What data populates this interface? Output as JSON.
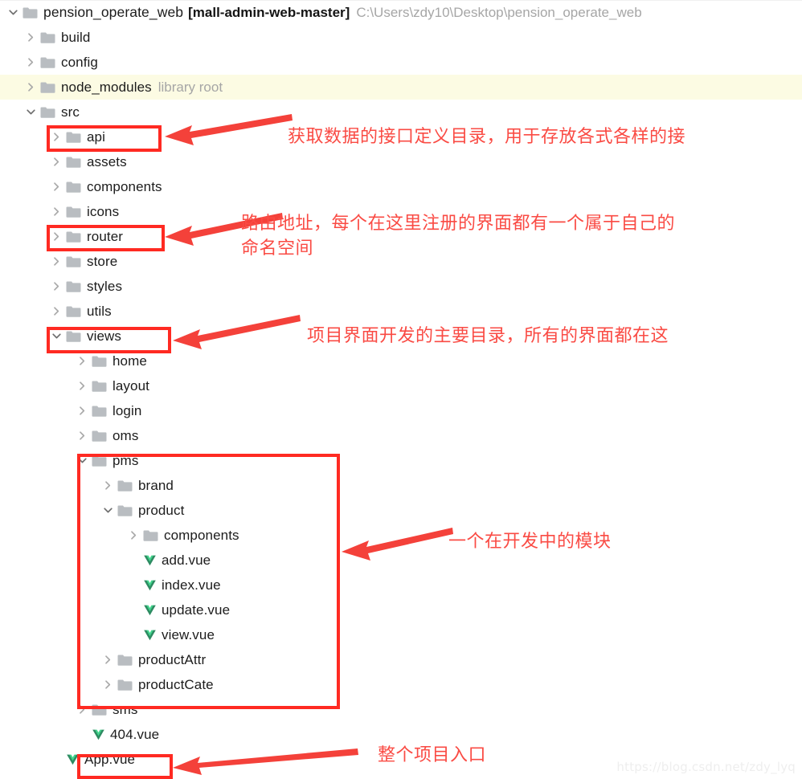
{
  "window": {
    "watermark": "https://blog.csdn.net/zdy_lyq"
  },
  "tree": {
    "root": {
      "name": "pension_operate_web",
      "tag": "[mall-admin-web-master]",
      "path": "C:\\Users\\zdy10\\Desktop\\pension_operate_web"
    },
    "rows": [
      {
        "label": "pension_operate_web",
        "tag": "[mall-admin-web-master]",
        "note": "C:\\Users\\zdy10\\Desktop\\pension_operate_web",
        "kind": "folder",
        "state": "expanded",
        "depth": 0,
        "highlight": false
      },
      {
        "label": "build",
        "tag": "",
        "note": "",
        "kind": "folder",
        "state": "collapsed",
        "depth": 1,
        "highlight": false
      },
      {
        "label": "config",
        "tag": "",
        "note": "",
        "kind": "folder",
        "state": "collapsed",
        "depth": 1,
        "highlight": false
      },
      {
        "label": "node_modules",
        "tag": "",
        "note": "library root",
        "kind": "folder",
        "state": "collapsed",
        "depth": 1,
        "highlight": true
      },
      {
        "label": "src",
        "tag": "",
        "note": "",
        "kind": "folder",
        "state": "expanded",
        "depth": 1,
        "highlight": false
      },
      {
        "label": "api",
        "tag": "",
        "note": "",
        "kind": "folder",
        "state": "collapsed",
        "depth": 2,
        "highlight": false
      },
      {
        "label": "assets",
        "tag": "",
        "note": "",
        "kind": "folder",
        "state": "collapsed",
        "depth": 2,
        "highlight": false
      },
      {
        "label": "components",
        "tag": "",
        "note": "",
        "kind": "folder",
        "state": "collapsed",
        "depth": 2,
        "highlight": false
      },
      {
        "label": "icons",
        "tag": "",
        "note": "",
        "kind": "folder",
        "state": "collapsed",
        "depth": 2,
        "highlight": false
      },
      {
        "label": "router",
        "tag": "",
        "note": "",
        "kind": "folder",
        "state": "collapsed",
        "depth": 2,
        "highlight": false
      },
      {
        "label": "store",
        "tag": "",
        "note": "",
        "kind": "folder",
        "state": "collapsed",
        "depth": 2,
        "highlight": false
      },
      {
        "label": "styles",
        "tag": "",
        "note": "",
        "kind": "folder",
        "state": "collapsed",
        "depth": 2,
        "highlight": false
      },
      {
        "label": "utils",
        "tag": "",
        "note": "",
        "kind": "folder",
        "state": "collapsed",
        "depth": 2,
        "highlight": false
      },
      {
        "label": "views",
        "tag": "",
        "note": "",
        "kind": "folder",
        "state": "expanded",
        "depth": 2,
        "highlight": false
      },
      {
        "label": "home",
        "tag": "",
        "note": "",
        "kind": "folder",
        "state": "collapsed",
        "depth": 3,
        "highlight": false
      },
      {
        "label": "layout",
        "tag": "",
        "note": "",
        "kind": "folder",
        "state": "collapsed",
        "depth": 3,
        "highlight": false
      },
      {
        "label": "login",
        "tag": "",
        "note": "",
        "kind": "folder",
        "state": "collapsed",
        "depth": 3,
        "highlight": false
      },
      {
        "label": "oms",
        "tag": "",
        "note": "",
        "kind": "folder",
        "state": "collapsed",
        "depth": 3,
        "highlight": false
      },
      {
        "label": "pms",
        "tag": "",
        "note": "",
        "kind": "folder",
        "state": "expanded",
        "depth": 3,
        "highlight": false
      },
      {
        "label": "brand",
        "tag": "",
        "note": "",
        "kind": "folder",
        "state": "collapsed",
        "depth": 4,
        "highlight": false
      },
      {
        "label": "product",
        "tag": "",
        "note": "",
        "kind": "folder",
        "state": "expanded",
        "depth": 4,
        "highlight": false
      },
      {
        "label": "components",
        "tag": "",
        "note": "",
        "kind": "folder",
        "state": "collapsed",
        "depth": 5,
        "highlight": false
      },
      {
        "label": "add.vue",
        "tag": "",
        "note": "",
        "kind": "vue",
        "state": "leaf",
        "depth": 5,
        "highlight": false
      },
      {
        "label": "index.vue",
        "tag": "",
        "note": "",
        "kind": "vue",
        "state": "leaf",
        "depth": 5,
        "highlight": false
      },
      {
        "label": "update.vue",
        "tag": "",
        "note": "",
        "kind": "vue",
        "state": "leaf",
        "depth": 5,
        "highlight": false
      },
      {
        "label": "view.vue",
        "tag": "",
        "note": "",
        "kind": "vue",
        "state": "leaf",
        "depth": 5,
        "highlight": false
      },
      {
        "label": "productAttr",
        "tag": "",
        "note": "",
        "kind": "folder",
        "state": "collapsed",
        "depth": 4,
        "highlight": false
      },
      {
        "label": "productCate",
        "tag": "",
        "note": "",
        "kind": "folder",
        "state": "collapsed",
        "depth": 4,
        "highlight": false
      },
      {
        "label": "sms",
        "tag": "",
        "note": "",
        "kind": "folder",
        "state": "collapsed",
        "depth": 3,
        "highlight": false
      },
      {
        "label": "404.vue",
        "tag": "",
        "note": "",
        "kind": "vue",
        "state": "leaf",
        "depth": 3,
        "highlight": false
      },
      {
        "label": "App.vue",
        "tag": "",
        "note": "",
        "kind": "vue",
        "state": "leaf",
        "depth": 2,
        "highlight": false
      }
    ]
  },
  "annotations": [
    {
      "id": "api",
      "text": "获取数据的接口定义目录，用于存放各式各样的接"
    },
    {
      "id": "router",
      "text": "路由地址，每个在这里注册的界面都有一个属于自己的\n命名空间"
    },
    {
      "id": "views",
      "text": "项目界面开发的主要目录，所有的界面都在这"
    },
    {
      "id": "pms",
      "text": "一个在开发中的模块"
    },
    {
      "id": "appvue",
      "text": "整个项目入口"
    }
  ],
  "colors": {
    "annotation_red": "#fa4b44",
    "box_red": "#ff2a22",
    "highlight_row": "#fcfbe3",
    "folder_icon": "#b8bcc0",
    "vue_icon_dark": "#2f8b63",
    "vue_icon_light": "#3fd18b"
  }
}
